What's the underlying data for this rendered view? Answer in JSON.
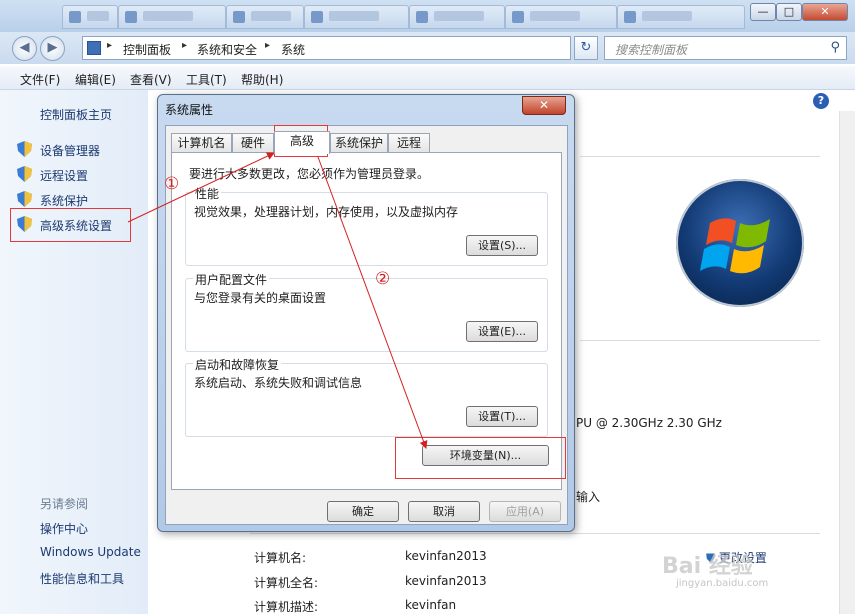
{
  "titlebar": {
    "controls": {
      "minimize": "—",
      "maximize": "□",
      "close": "✕"
    }
  },
  "nav": {
    "back_icon": "◀",
    "forward_icon": "▶",
    "breadcrumbs": [
      "控制面板",
      "系统和安全",
      "系统"
    ],
    "search_placeholder": "搜索控制面板",
    "refresh_icon": "↻",
    "search_icon": "⚲"
  },
  "menu": [
    "文件(F)",
    "编辑(E)",
    "查看(V)",
    "工具(T)",
    "帮助(H)"
  ],
  "sidebar": {
    "home": "控制面板主页",
    "items": [
      "设备管理器",
      "远程设置",
      "系统保护",
      "高级系统设置"
    ],
    "see_also_header": "另请参阅",
    "see_also": [
      "操作中心",
      "Windows Update",
      "性能信息和工具"
    ]
  },
  "background": {
    "cpu_text": "PU @ 2.30GHz   2.30 GHz",
    "input_text": "输入",
    "computer_rows": [
      {
        "label": "计算机名:",
        "value": "kevinfan2013"
      },
      {
        "label": "计算机全名:",
        "value": "kevinfan2013"
      },
      {
        "label": "计算机描述:",
        "value": "kevinfan"
      }
    ],
    "change_settings": "更改设置"
  },
  "dialog": {
    "title": "系统属性",
    "close": "✕",
    "tabs": [
      "计算机名",
      "硬件",
      "高级",
      "系统保护",
      "远程"
    ],
    "active_tab": "高级",
    "admin_note": "要进行大多数更改，您必须作为管理员登录。",
    "groups": [
      {
        "title": "性能",
        "desc": "视觉效果，处理器计划，内存使用，以及虚拟内存",
        "button": "设置(S)..."
      },
      {
        "title": "用户配置文件",
        "desc": "与您登录有关的桌面设置",
        "button": "设置(E)..."
      },
      {
        "title": "启动和故障恢复",
        "desc": "系统启动、系统失败和调试信息",
        "button": "设置(T)..."
      }
    ],
    "env_button": "环境变量(N)...",
    "ok": "确定",
    "cancel": "取消",
    "apply": "应用(A)"
  },
  "annotations": {
    "step1": "①",
    "step2": "②",
    "accent": "#d42020"
  },
  "watermark": {
    "main": "Bai 经验",
    "sub": "jingyan.baidu.com"
  }
}
